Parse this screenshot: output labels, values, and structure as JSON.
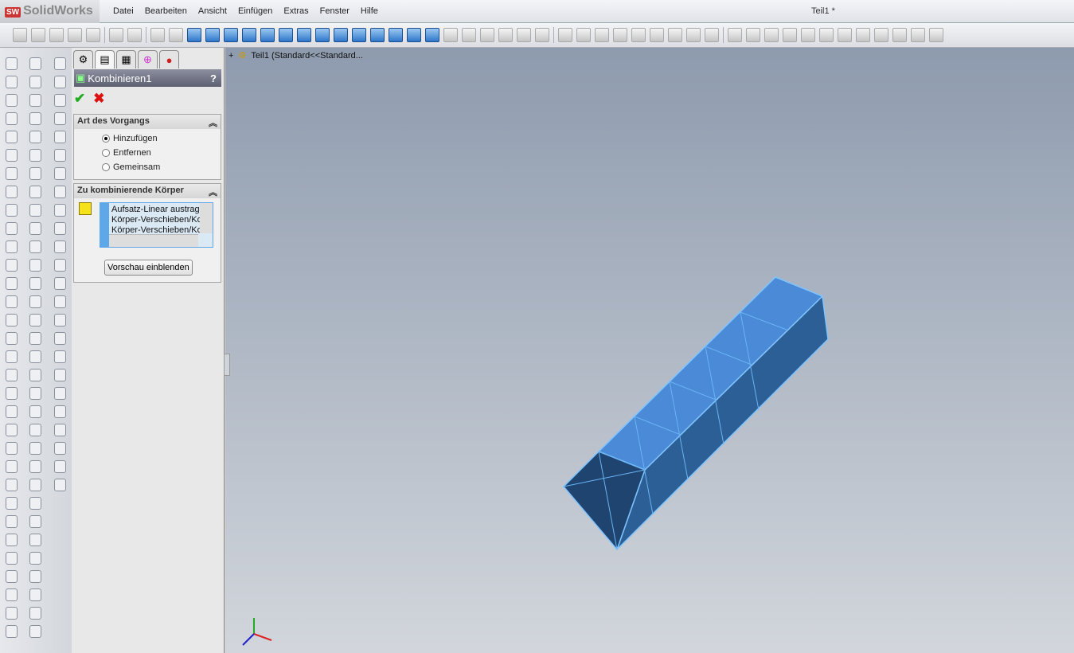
{
  "app": {
    "name": "SolidWorks",
    "logo_badge": "SW",
    "document_title": "Teil1 *"
  },
  "menu": [
    "Datei",
    "Bearbeiten",
    "Ansicht",
    "Einfügen",
    "Extras",
    "Fenster",
    "Hilfe"
  ],
  "panel": {
    "title": "Kombinieren1",
    "help": "?",
    "ok": "✔",
    "cancel": "✖",
    "operation": {
      "heading": "Art des Vorgangs",
      "options": [
        "Hinzufügen",
        "Entfernen",
        "Gemeinsam"
      ],
      "selected": "Hinzufügen"
    },
    "bodies": {
      "heading": "Zu kombinierende Körper",
      "items": [
        "Aufsatz-Linear austrag",
        "Körper-Verschieben/Ko",
        "Körper-Verschieben/Ko"
      ]
    },
    "preview_button": "Vorschau einblenden"
  },
  "tree": {
    "root": "Teil1  (Standard<<Standard..."
  },
  "colors": {
    "body": "#4a90d9",
    "edge": "#7fc4ff",
    "end_face": "#1f4470"
  }
}
